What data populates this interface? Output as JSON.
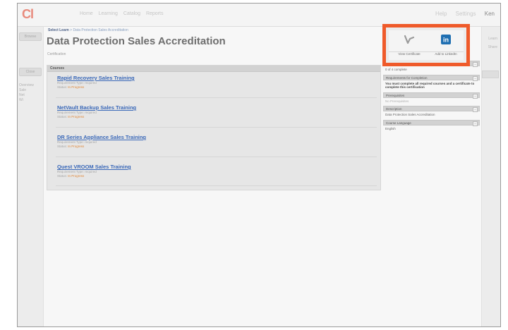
{
  "topbar": {
    "logo": "Cl",
    "nav": [
      "Home",
      "Learning",
      "Catalog",
      "Reports"
    ],
    "right_links": [
      "Help",
      "Settings"
    ],
    "user": "Ken"
  },
  "breadcrumb": {
    "first": "Select Learn",
    "rest": "> Data Protection Sales Accreditation"
  },
  "page": {
    "title": "Data Protection Sales Accreditation",
    "subtitle": "Certification"
  },
  "left_rail": {
    "button_1": "Browse",
    "button_2": "Close",
    "text": [
      "Overview",
      "Sale",
      "Net",
      "Wi"
    ]
  },
  "right_rail": {
    "links": [
      "Learn",
      "Share",
      "Report"
    ]
  },
  "courses": {
    "panel_label": "Courses",
    "items": [
      {
        "title": "Rapid Recovery Sales Training",
        "requirement": "Requirement Type: required",
        "status_label": "Status: ",
        "status": "In Progress"
      },
      {
        "title": "NetVault Backup Sales Training",
        "requirement": "Requirement Type: required",
        "status_label": "Status: ",
        "status": "In Progress"
      },
      {
        "title": "DR Series Appliance Sales Training",
        "requirement": "Requirement Type: required",
        "status_label": "Status: ",
        "status": "In Progress"
      },
      {
        "title": "Quest VROOM Sales Training",
        "requirement": "Requirement Type: required",
        "status_label": "Status: ",
        "status": "In Progress"
      }
    ]
  },
  "info": {
    "sections": [
      {
        "head": "Total Progress",
        "body": "0 of 4 complete",
        "style": ""
      },
      {
        "head": "Requirements for Completion",
        "body": "You must complete all required courses and a certificate to complete this certification",
        "style": "bold"
      },
      {
        "head": "Prerequisites",
        "body": "No Prerequisites",
        "style": "muted"
      },
      {
        "head": "Description",
        "body": "Data Protection Sales Accreditation",
        "style": ""
      },
      {
        "head": "Course Language",
        "body": "English",
        "style": ""
      }
    ]
  },
  "share": {
    "certificate_label": "View Certificate",
    "linkedin_label": "Add to LinkedIn",
    "linkedin_glyph": "in",
    "accent": "#ef5a2a",
    "linkedin_color": "#1f6fb2"
  }
}
